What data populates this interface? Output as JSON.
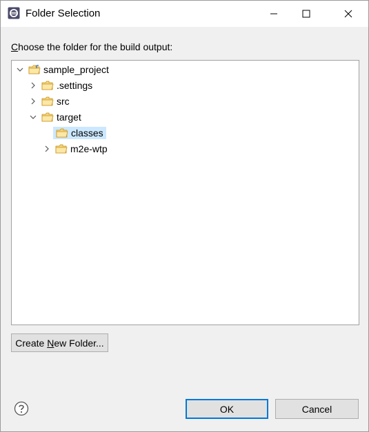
{
  "window": {
    "title": "Folder Selection",
    "app_icon": "eclipse-icon",
    "controls": [
      "minimize-icon",
      "maximize-icon",
      "close-icon"
    ]
  },
  "prompt": {
    "before": "",
    "mnemonic": "C",
    "after": "hoose the folder for the build output:"
  },
  "tree": [
    {
      "label": "sample_project",
      "depth": 0,
      "expanded": true,
      "icon": "project-folder-icon"
    },
    {
      "label": ".settings",
      "depth": 1,
      "expanded": false,
      "icon": "folder-icon"
    },
    {
      "label": "src",
      "depth": 1,
      "expanded": false,
      "icon": "folder-icon"
    },
    {
      "label": "target",
      "depth": 1,
      "expanded": true,
      "icon": "folder-icon"
    },
    {
      "label": "classes",
      "depth": 2,
      "expanded": null,
      "selected": true,
      "icon": "folder-icon"
    },
    {
      "label": "m2e-wtp",
      "depth": 2,
      "expanded": false,
      "icon": "folder-icon"
    }
  ],
  "buttons": {
    "create_before": "Create ",
    "create_mnemonic": "N",
    "create_after": "ew Folder...",
    "ok": "OK",
    "cancel": "Cancel"
  },
  "help_icon": "help-icon",
  "colors": {
    "selection": "#cce8ff",
    "default_button_border": "#0078d7",
    "folder": "#e8a825"
  }
}
